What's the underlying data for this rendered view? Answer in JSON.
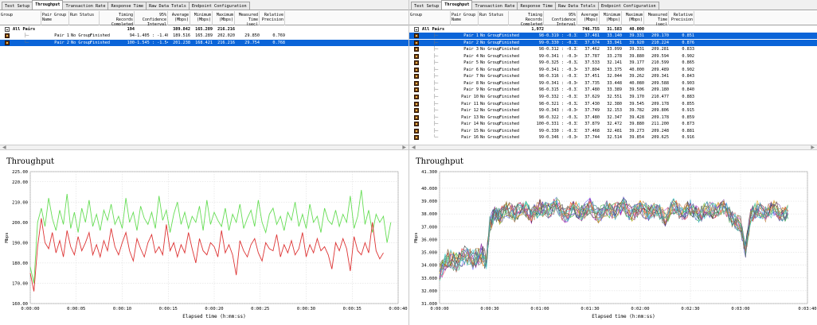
{
  "tabs": [
    "Test Setup",
    "Throughput",
    "Transaction Rate",
    "Response Time",
    "Raw Data Totals",
    "Endpoint Configuration"
  ],
  "active_tab": "Throughput",
  "columns": {
    "group": "Group",
    "pair_group_name": "Pair Group Name",
    "run_status": "Run Status",
    "timing_records": "Timing Records Completed",
    "confidence": "95% Confidence Interval",
    "average": "Average (Mbps)",
    "minimum": "Minimum (Mbps)",
    "maximum": "Maximum (Mbps)",
    "measured_time": "Measured Time (sec)",
    "relative_precision": "Relative Precision"
  },
  "left_table": {
    "total": {
      "label": "All Pairs",
      "records": "194",
      "average": "389.842",
      "minimum": "165.289",
      "maximum": "216.216"
    },
    "rows": [
      {
        "pair": "Pair 1",
        "group": "No Group",
        "status": "Finished",
        "records": "94",
        "ci": "-1.405 : -1.405",
        "avg": "189.516",
        "min": "165.289",
        "max": "202.020",
        "time": "29.850",
        "rp": "0.769",
        "selected": false
      },
      {
        "pair": "Pair 2",
        "group": "No Group",
        "status": "Finished",
        "records": "100",
        "ci": "-1.545 : -1.545",
        "avg": "201.238",
        "min": "168.421",
        "max": "216.216",
        "time": "29.754",
        "rp": "0.768",
        "selected": true
      }
    ]
  },
  "right_table": {
    "total": {
      "label": "All Pairs",
      "records": "1,972",
      "average": "746.755",
      "minimum": "31.583",
      "maximum": "40.000"
    },
    "rows": [
      {
        "pair": "Pair 1",
        "group": "No Group",
        "status": "Finished",
        "records": "98",
        "ci": "-0.319 : -0.319",
        "avg": "37.481",
        "min": "33.140",
        "max": "39.331",
        "time": "209.170",
        "rp": "0.851",
        "selected": true
      },
      {
        "pair": "Pair 2",
        "group": "No Group",
        "status": "Finished",
        "records": "99",
        "ci": "-0.330 : -0.330",
        "avg": "37.674",
        "min": "33.941",
        "max": "39.920",
        "time": "210.224",
        "rp": "0.876",
        "selected": true
      },
      {
        "pair": "Pair 3",
        "group": "No Group",
        "status": "Finished",
        "records": "98",
        "ci": "-0.312 : -0.312",
        "avg": "37.462",
        "min": "33.099",
        "max": "39.331",
        "time": "209.281",
        "rp": "0.833",
        "selected": false
      },
      {
        "pair": "Pair 4",
        "group": "No Group",
        "status": "Finished",
        "records": "99",
        "ci": "-0.341 : -0.341",
        "avg": "37.787",
        "min": "33.278",
        "max": "39.880",
        "time": "209.594",
        "rp": "0.902",
        "selected": false
      },
      {
        "pair": "Pair 5",
        "group": "No Group",
        "status": "Finished",
        "records": "99",
        "ci": "-0.325 : -0.325",
        "avg": "37.533",
        "min": "32.141",
        "max": "39.177",
        "time": "210.599",
        "rp": "0.865",
        "selected": false
      },
      {
        "pair": "Pair 6",
        "group": "No Group",
        "status": "Finished",
        "records": "99",
        "ci": "-0.341 : -0.341",
        "avg": "37.804",
        "min": "33.375",
        "max": "40.000",
        "time": "209.489",
        "rp": "0.902",
        "selected": false
      },
      {
        "pair": "Pair 7",
        "group": "No Group",
        "status": "Finished",
        "records": "98",
        "ci": "-0.316 : -0.316",
        "avg": "37.451",
        "min": "32.044",
        "max": "39.262",
        "time": "209.341",
        "rp": "0.843",
        "selected": false
      },
      {
        "pair": "Pair 8",
        "group": "No Group",
        "status": "Finished",
        "records": "99",
        "ci": "-0.341 : -0.341",
        "avg": "37.735",
        "min": "33.448",
        "max": "40.080",
        "time": "209.588",
        "rp": "0.903",
        "selected": false
      },
      {
        "pair": "Pair 9",
        "group": "No Group",
        "status": "Finished",
        "records": "98",
        "ci": "-0.315 : -0.315",
        "avg": "37.480",
        "min": "33.389",
        "max": "39.506",
        "time": "209.180",
        "rp": "0.840",
        "selected": false
      },
      {
        "pair": "Pair 10",
        "group": "No Group",
        "status": "Finished",
        "records": "99",
        "ci": "-0.332 : -0.332",
        "avg": "37.629",
        "min": "32.551",
        "max": "39.170",
        "time": "210.477",
        "rp": "0.883",
        "selected": false
      },
      {
        "pair": "Pair 11",
        "group": "No Group",
        "status": "Finished",
        "records": "98",
        "ci": "-0.321 : -0.321",
        "avg": "37.430",
        "min": "32.380",
        "max": "39.545",
        "time": "209.178",
        "rp": "0.855",
        "selected": false
      },
      {
        "pair": "Pair 12",
        "group": "No Group",
        "status": "Finished",
        "records": "99",
        "ci": "-0.343 : -0.343",
        "avg": "37.749",
        "min": "32.153",
        "max": "39.782",
        "time": "209.806",
        "rp": "0.915",
        "selected": false
      },
      {
        "pair": "Pair 13",
        "group": "No Group",
        "status": "Finished",
        "records": "98",
        "ci": "-0.322 : -0.322",
        "avg": "37.480",
        "min": "32.347",
        "max": "39.428",
        "time": "209.178",
        "rp": "0.859",
        "selected": false
      },
      {
        "pair": "Pair 14",
        "group": "No Group",
        "status": "Finished",
        "records": "100",
        "ci": "-0.331 : -0.331",
        "avg": "37.879",
        "min": "32.472",
        "max": "39.880",
        "time": "211.200",
        "rp": "0.873",
        "selected": false
      },
      {
        "pair": "Pair 15",
        "group": "No Group",
        "status": "Finished",
        "records": "99",
        "ci": "-0.330 : -0.330",
        "avg": "37.468",
        "min": "32.481",
        "max": "39.273",
        "time": "209.248",
        "rp": "0.881",
        "selected": false
      },
      {
        "pair": "Pair 16",
        "group": "No Group",
        "status": "Finished",
        "records": "99",
        "ci": "-0.346 : -0.346",
        "avg": "37.744",
        "min": "32.514",
        "max": "39.854",
        "time": "209.625",
        "rp": "0.916",
        "selected": false
      }
    ]
  },
  "chart_data": [
    {
      "type": "line",
      "title": "Throughput",
      "xlabel": "Elapsed time (h:mm:ss)",
      "ylabel": "Mbps",
      "xlim": [
        0,
        40
      ],
      "ylim": [
        160,
        225
      ],
      "yticks": [
        "160.00",
        "170.00",
        "180.00",
        "190.00",
        "200.00",
        "210.00",
        "220.00",
        "225.00"
      ],
      "ytick_values": [
        160,
        170,
        180,
        190,
        200,
        210,
        220,
        225
      ],
      "xticks": [
        "0:00:00",
        "0:00:05",
        "0:00:10",
        "0:00:15",
        "0:00:20",
        "0:00:25",
        "0:00:30",
        "0:00:35",
        "0:00:40"
      ],
      "xtick_values": [
        0,
        5,
        10,
        15,
        20,
        25,
        30,
        35,
        40
      ],
      "grid": true,
      "series": [
        {
          "color": "#66dd55",
          "x": [
            0,
            0.4,
            0.8,
            1.2,
            1.6,
            2,
            2.4,
            2.8,
            3.2,
            3.6,
            4,
            4.4,
            4.8,
            5.2,
            5.6,
            6,
            6.4,
            6.8,
            7.2,
            7.6,
            8,
            8.4,
            8.8,
            9.2,
            9.6,
            10,
            10.4,
            10.8,
            11.2,
            11.6,
            12,
            12.4,
            12.8,
            13.2,
            13.6,
            14,
            14.4,
            14.8,
            15.2,
            15.6,
            16,
            16.4,
            16.8,
            17.2,
            17.6,
            18,
            18.4,
            18.8,
            19.2,
            19.6,
            20,
            20.4,
            20.8,
            21.2,
            21.6,
            22,
            22.4,
            22.8,
            23.2,
            23.6,
            24,
            24.4,
            24.8,
            25.2,
            25.6,
            26,
            26.4,
            26.8,
            27.2,
            27.6,
            28,
            28.4,
            28.8,
            29.2,
            29.6,
            30,
            30.4,
            30.8,
            31.2,
            31.6,
            32,
            32.4,
            32.8,
            33.2,
            33.6,
            34,
            34.4,
            34.8,
            35.2,
            35.6,
            36,
            36.4,
            36.8,
            37.2,
            37.6,
            38,
            38.4,
            38.8,
            39.2
          ],
          "y": [
            178,
            170,
            200,
            207,
            198,
            212,
            202,
            196,
            206,
            199,
            214,
            197,
            205,
            195,
            207,
            200,
            211,
            198,
            204,
            196,
            206,
            201,
            209,
            199,
            203,
            197,
            212,
            200,
            205,
            196,
            208,
            202,
            199,
            205,
            197,
            213,
            201,
            206,
            195,
            204,
            210,
            199,
            205,
            197,
            203,
            200,
            208,
            196,
            211,
            199,
            205,
            201,
            198,
            207,
            196,
            204,
            200,
            209,
            197,
            202,
            206,
            198,
            211,
            200,
            195,
            204,
            207,
            199,
            203,
            196,
            205,
            201,
            210,
            198,
            204,
            197,
            209,
            200,
            203,
            195,
            207,
            201,
            199,
            206,
            198,
            204,
            200,
            213,
            197,
            203,
            216,
            199,
            206,
            195,
            204,
            200,
            203,
            190,
            200
          ]
        },
        {
          "color": "#dd3333",
          "x": [
            0,
            0.4,
            0.8,
            1.2,
            1.6,
            2,
            2.4,
            2.8,
            3.2,
            3.6,
            4,
            4.4,
            4.8,
            5.2,
            5.6,
            6,
            6.4,
            6.8,
            7.2,
            7.6,
            8,
            8.4,
            8.8,
            9.2,
            9.6,
            10,
            10.4,
            10.8,
            11.2,
            11.6,
            12,
            12.4,
            12.8,
            13.2,
            13.6,
            14,
            14.4,
            14.8,
            15.2,
            15.6,
            16,
            16.4,
            16.8,
            17.2,
            17.6,
            18,
            18.4,
            18.8,
            19.2,
            19.6,
            20,
            20.4,
            20.8,
            21.2,
            21.6,
            22,
            22.4,
            22.8,
            23.2,
            23.6,
            24,
            24.4,
            24.8,
            25.2,
            25.6,
            26,
            26.4,
            26.8,
            27.2,
            27.6,
            28,
            28.4,
            28.8,
            29.2,
            29.6,
            30,
            30.4,
            30.8,
            31.2,
            31.6,
            32,
            32.4,
            32.8,
            33.2,
            33.6,
            34,
            34.4,
            34.8,
            35.2,
            35.6,
            36,
            36.4,
            36.8,
            37.2,
            37.6,
            38,
            38.4
          ],
          "y": [
            175,
            166,
            188,
            202,
            190,
            187,
            195,
            185,
            191,
            183,
            196,
            188,
            184,
            193,
            186,
            190,
            195,
            184,
            189,
            183,
            191,
            186,
            197,
            188,
            184,
            190,
            195,
            186,
            181,
            192,
            187,
            183,
            190,
            194,
            185,
            188,
            184,
            199,
            186,
            190,
            183,
            189,
            185,
            195,
            187,
            180,
            192,
            186,
            184,
            190,
            188,
            183,
            196,
            185,
            189,
            184,
            174,
            191,
            186,
            183,
            189,
            192,
            185,
            181,
            190,
            187,
            186,
            194,
            183,
            189,
            185,
            191,
            184,
            187,
            195,
            183,
            189,
            185,
            192,
            186,
            188,
            184,
            177,
            190,
            186,
            192,
            187,
            176,
            193,
            186,
            184,
            190,
            185,
            200,
            186,
            182,
            185
          ]
        }
      ]
    },
    {
      "type": "line",
      "title": "Throughput",
      "xlabel": "Elapsed time (h:mm:ss)",
      "ylabel": "Mbps",
      "xlim": [
        0,
        220
      ],
      "ylim": [
        31,
        41.3
      ],
      "yticks": [
        "31.000",
        "32.000",
        "33.000",
        "34.000",
        "35.000",
        "36.000",
        "37.000",
        "38.000",
        "39.000",
        "40.000",
        "41.300"
      ],
      "ytick_values": [
        31,
        32,
        33,
        34,
        35,
        36,
        37,
        38,
        39,
        40,
        41.3
      ],
      "xticks": [
        "0:00:00",
        "0:00:30",
        "0:01:00",
        "0:01:30",
        "0:02:00",
        "0:02:30",
        "0:03:00",
        "0:03:40"
      ],
      "xtick_values": [
        0,
        30,
        60,
        90,
        120,
        150,
        180,
        220
      ],
      "grid": true,
      "base_profile": {
        "x": [
          0,
          5,
          10,
          15,
          20,
          25,
          28,
          30,
          33,
          36,
          40,
          45,
          50,
          55,
          60,
          65,
          70,
          75,
          80,
          85,
          90,
          95,
          100,
          105,
          110,
          115,
          120,
          125,
          130,
          135,
          140,
          145,
          150,
          155,
          160,
          165,
          170,
          175,
          180,
          183,
          186,
          190,
          195,
          200,
          205,
          210
        ],
        "y": [
          33.5,
          34.6,
          34.2,
          34.8,
          34.4,
          34.9,
          34.3,
          37.2,
          38.0,
          37.8,
          38.4,
          38.0,
          38.6,
          37.9,
          38.5,
          38.2,
          38.7,
          37.8,
          38.5,
          38.1,
          38.6,
          37.9,
          38.4,
          38.2,
          38.7,
          37.9,
          38.5,
          38.1,
          38.4,
          37.7,
          38.6,
          38.0,
          38.5,
          37.9,
          38.4,
          38.2,
          38.6,
          37.6,
          37.2,
          35.2,
          37.8,
          38.4,
          38.0,
          38.5,
          37.9,
          38.2
        ]
      },
      "series_count": 16,
      "series_colors": [
        "#1a1aa0",
        "#d02020",
        "#20a020",
        "#c020c0",
        "#20a0c0",
        "#a06020",
        "#202020",
        "#e0a000",
        "#6060ff",
        "#ff6060",
        "#60c060",
        "#8040a0",
        "#40c0a0",
        "#c08040",
        "#606060",
        "#30d0d0"
      ]
    }
  ]
}
